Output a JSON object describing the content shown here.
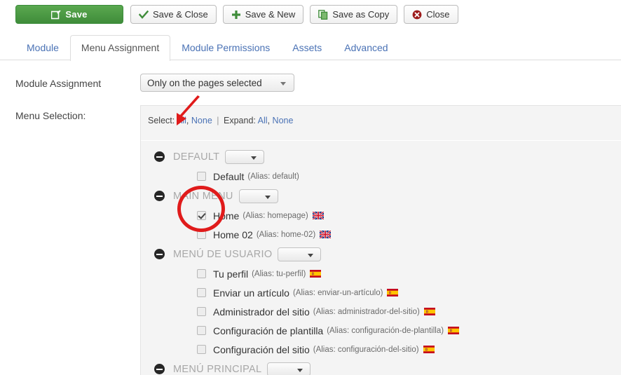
{
  "toolbar": {
    "buttons": [
      {
        "label": "Save",
        "icon": "edit-icon",
        "style": "primary"
      },
      {
        "label": "Save & Close",
        "icon": "check-icon",
        "style": "default"
      },
      {
        "label": "Save & New",
        "icon": "plus-icon",
        "style": "default"
      },
      {
        "label": "Save as Copy",
        "icon": "copy-icon",
        "style": "default"
      },
      {
        "label": "Close",
        "icon": "close-circle-icon",
        "style": "default"
      }
    ]
  },
  "tabs": [
    {
      "label": "Module",
      "active": false
    },
    {
      "label": "Menu Assignment",
      "active": true
    },
    {
      "label": "Module Permissions",
      "active": false
    },
    {
      "label": "Assets",
      "active": false
    },
    {
      "label": "Advanced",
      "active": false
    }
  ],
  "form": {
    "module_assignment_label": "Module Assignment",
    "module_assignment_value": "Only on the pages selected",
    "menu_selection_label": "Menu Selection:"
  },
  "panel": {
    "select_prefix": "Select:",
    "select_all": "All",
    "comma": ",",
    "select_none": "None",
    "divider": "|",
    "expand_prefix": "Expand:",
    "expand_all": "All",
    "expand_none": "None",
    "alias_prefix": "Alias:"
  },
  "tree": [
    {
      "group": "DEFAULT",
      "items": [
        {
          "label": "Default",
          "alias": "(Alias: default)",
          "checked": false,
          "flag": "none"
        }
      ]
    },
    {
      "group": "MAIN MENU",
      "items": [
        {
          "label": "Home",
          "alias": "(Alias: homepage)",
          "checked": true,
          "flag": "uk"
        },
        {
          "label": "Home 02",
          "alias": "(Alias: home-02)",
          "checked": false,
          "flag": "uk"
        }
      ]
    },
    {
      "group": "MENÚ DE USUARIO",
      "items": [
        {
          "label": "Tu perfil",
          "alias": "(Alias: tu-perfil)",
          "checked": false,
          "flag": "es"
        },
        {
          "label": "Enviar un artículo",
          "alias": "(Alias: enviar-un-artículo)",
          "checked": false,
          "flag": "es"
        },
        {
          "label": "Administrador del sitio",
          "alias": "(Alias: administrador-del-sitio)",
          "checked": false,
          "flag": "es"
        },
        {
          "label": "Configuración de plantilla",
          "alias": "(Alias: configuración-de-plantilla)",
          "checked": false,
          "flag": "es"
        },
        {
          "label": "Configuración del sitio",
          "alias": "(Alias: configuración-del-sitio)",
          "checked": false,
          "flag": "es"
        }
      ]
    },
    {
      "group": "MENÚ PRINCIPAL",
      "items": []
    }
  ],
  "annotations": {
    "arrow": {
      "name": "red-arrow-pointing-to-select-none"
    },
    "circle": {
      "name": "red-circle-around-home-checkbox"
    }
  },
  "colors": {
    "primary_green": "#3f8c3a",
    "link_blue": "#4a72b5",
    "annotation_red": "#e01b1b",
    "panel_bg": "#f4f4f4"
  }
}
